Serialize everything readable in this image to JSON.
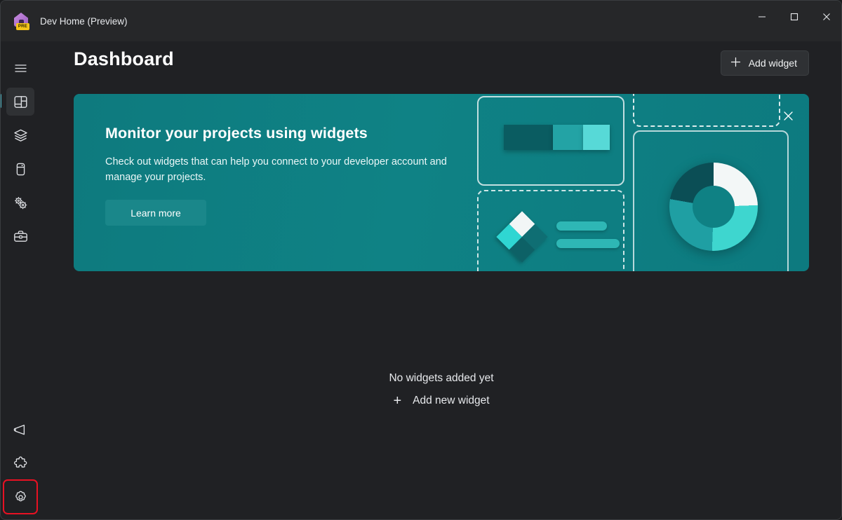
{
  "window": {
    "app_title": "Dev Home (Preview)",
    "app_icon": "house-icon",
    "badge_text": "PRE",
    "minimize_label": "Minimize",
    "maximize_label": "Maximize",
    "close_label": "Close"
  },
  "sidebar": {
    "menu_toggle": {
      "name": "hamburger-menu-icon",
      "label": "Navigation menu"
    },
    "items": [
      {
        "icon": "dashboard-icon",
        "label": "Dashboard",
        "selected": true
      },
      {
        "icon": "layers-icon",
        "label": "Machine configuration",
        "selected": false
      },
      {
        "icon": "device-icon",
        "label": "Environments",
        "selected": false
      },
      {
        "icon": "gears-icon",
        "label": "Utilities",
        "selected": false
      },
      {
        "icon": "toolbox-icon",
        "label": "Dev Insights",
        "selected": false
      }
    ],
    "bottom_items": [
      {
        "icon": "megaphone-icon",
        "label": "Feedback",
        "highlighted": false
      },
      {
        "icon": "puzzle-icon",
        "label": "Extensions",
        "highlighted": false
      },
      {
        "icon": "gear-icon",
        "label": "Settings",
        "highlighted": true
      }
    ]
  },
  "header": {
    "title": "Dashboard",
    "add_widget_label": "Add widget",
    "add_widget_icon": "plus-icon"
  },
  "banner": {
    "title": "Monitor your projects using widgets",
    "description": "Check out widgets that can help you connect to your developer account and manage your projects.",
    "learn_more_label": "Learn more",
    "close_icon": "close-icon",
    "accent_color": "#0f8184"
  },
  "empty_state": {
    "title": "No widgets added yet",
    "add_label": "Add new widget",
    "add_icon": "plus-icon",
    "plus_glyph": "+"
  }
}
